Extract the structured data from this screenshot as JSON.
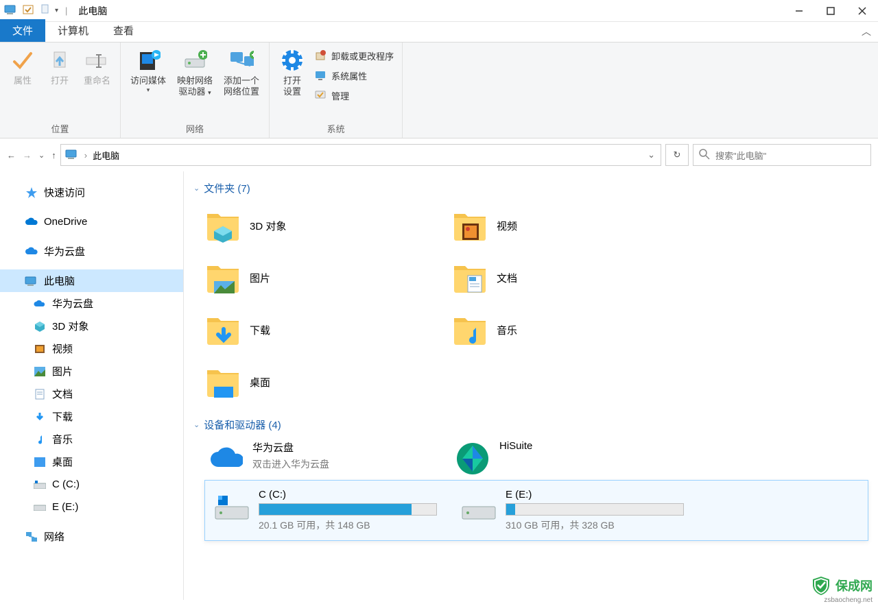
{
  "window": {
    "title": "此电脑"
  },
  "tabs": {
    "file": "文件",
    "computer": "计算机",
    "view": "查看"
  },
  "ribbon": {
    "properties": "属性",
    "open": "打开",
    "rename": "重命名",
    "access_media": "访问媒体",
    "map_drive_l1": "映射网络",
    "map_drive_l2": "驱动器",
    "add_net_l1": "添加一个",
    "add_net_l2": "网络位置",
    "open_settings_l1": "打开",
    "open_settings_l2": "设置",
    "uninstall": "卸载或更改程序",
    "sys_props": "系统属性",
    "manage": "管理",
    "group_location": "位置",
    "group_network": "网络",
    "group_system": "系统"
  },
  "addr": {
    "location": "此电脑"
  },
  "search": {
    "placeholder": "搜索\"此电脑\""
  },
  "sidebar": {
    "quick": "快速访问",
    "onedrive": "OneDrive",
    "huawei": "华为云盘",
    "thispc": "此电脑",
    "children": {
      "huawei": "华为云盘",
      "objects3d": "3D 对象",
      "videos": "视频",
      "pictures": "图片",
      "documents": "文档",
      "downloads": "下载",
      "music": "音乐",
      "desktop": "桌面",
      "drive_c": "C (C:)",
      "drive_e": "E  (E:)"
    },
    "network": "网络"
  },
  "groups": {
    "folders": "文件夹 (7)",
    "drives": "设备和驱动器 (4)"
  },
  "folders": {
    "objects3d": "3D 对象",
    "videos": "视频",
    "pictures": "图片",
    "documents": "文档",
    "downloads": "下载",
    "music": "音乐",
    "desktop": "桌面"
  },
  "drives": {
    "huawei": {
      "name": "华为云盘",
      "sub": "双击进入华为云盘"
    },
    "hisuite": {
      "name": "HiSuite"
    },
    "c": {
      "name": "C (C:)",
      "sub": "20.1 GB 可用，共 148 GB",
      "fill_pct": 86
    },
    "e": {
      "name": "E  (E:)",
      "sub": "310 GB 可用，共 328 GB",
      "fill_pct": 5
    }
  },
  "watermark": {
    "text": "保成网",
    "sub": "zsbaocheng.net"
  }
}
